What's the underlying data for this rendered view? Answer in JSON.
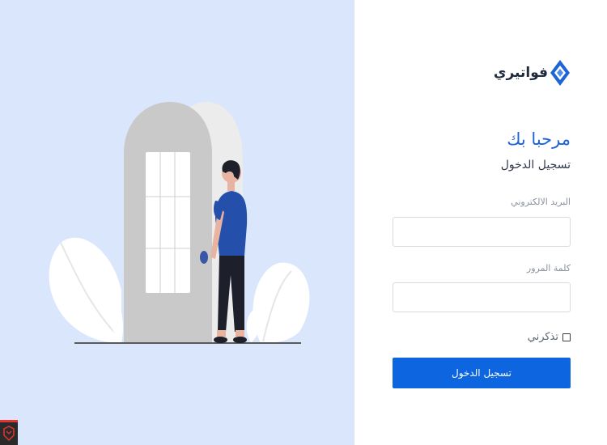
{
  "brand": {
    "name": "فواتيري",
    "icon": "diamond-logo-icon",
    "accent_color": "#1e63d8"
  },
  "login": {
    "welcome": "مرحبا بك",
    "subtitle": "تسجيل الدخول",
    "email_label": "البريد الالكتروني",
    "email_value": "",
    "password_label": "كلمة المرور",
    "password_value": "",
    "remember_label": "تذكرني",
    "submit_label": "تسجيل الدخول",
    "button_color": "#0d66e0"
  },
  "illustration": {
    "background_color": "#d9e6fb"
  }
}
